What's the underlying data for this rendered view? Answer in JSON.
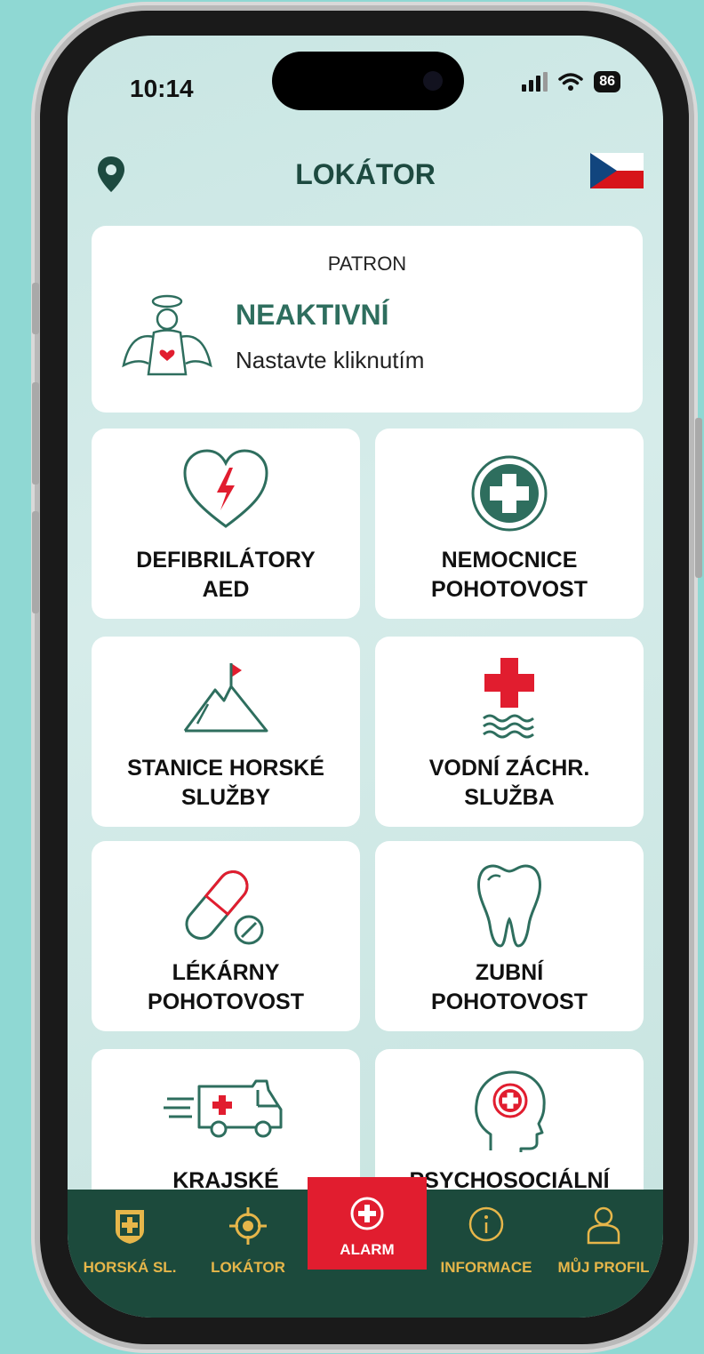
{
  "status_bar": {
    "time": "10:14",
    "battery": "86"
  },
  "header": {
    "title": "LOKÁTOR"
  },
  "patron": {
    "label": "PATRON",
    "status": "NEAKTIVNÍ",
    "hint": "Nastavte kliknutím"
  },
  "tiles": [
    {
      "line1": "DEFIBRILÁTORY",
      "line2": "AED",
      "icon": "heart-defibrillator-icon"
    },
    {
      "line1": "NEMOCNICE",
      "line2": "POHOTOVOST",
      "icon": "hospital-cross-icon"
    },
    {
      "line1": "STANICE HORSKÉ",
      "line2": "SLUŽBY",
      "icon": "mountain-flag-icon"
    },
    {
      "line1": "VODNÍ ZÁCHR.",
      "line2": "SLUŽBA",
      "icon": "water-rescue-icon"
    },
    {
      "line1": "LÉKÁRNY",
      "line2": "POHOTOVOST",
      "icon": "pills-icon"
    },
    {
      "line1": "ZUBNÍ",
      "line2": "POHOTOVOST",
      "icon": "tooth-icon"
    },
    {
      "line1": "KRAJSKÉ",
      "line2": "",
      "icon": "ambulance-icon"
    },
    {
      "line1": "PSYCHOSOCIÁLNÍ",
      "line2": "",
      "icon": "head-cross-icon"
    }
  ],
  "nav": {
    "horska": "HORSKÁ SL.",
    "lokator": "LOKÁTOR",
    "alarm": "ALARM",
    "informace": "INFORMACE",
    "profil": "MŮJ PROFIL"
  },
  "colors": {
    "primary": "#1c4a3c",
    "accent": "#e6b64a",
    "alarm": "#e11d2f",
    "text_green": "#2e6e5e"
  }
}
